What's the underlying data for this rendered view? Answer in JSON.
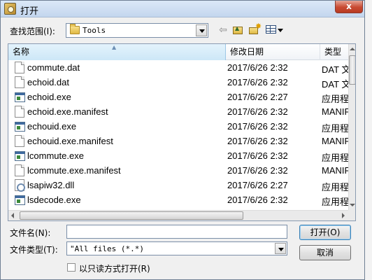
{
  "dialog": {
    "title": "打开",
    "close_label": "x"
  },
  "look_in": {
    "label": "查找范围(I):",
    "value": "Tools"
  },
  "columns": {
    "name": "名称",
    "date": "修改日期",
    "type": "类型"
  },
  "files": [
    {
      "name": "commute.dat",
      "date": "2017/6/26 2:32",
      "type": "DAT 文件",
      "icon": "document-icon"
    },
    {
      "name": "echoid.dat",
      "date": "2017/6/26 2:32",
      "type": "DAT 文件",
      "icon": "document-icon"
    },
    {
      "name": "echoid.exe",
      "date": "2017/6/26 2:27",
      "type": "应用程序",
      "icon": "application-icon"
    },
    {
      "name": "echoid.exe.manifest",
      "date": "2017/6/26 2:32",
      "type": "MANIFEST",
      "icon": "document-icon"
    },
    {
      "name": "echouid.exe",
      "date": "2017/6/26 2:32",
      "type": "应用程序",
      "icon": "application-icon"
    },
    {
      "name": "echouid.exe.manifest",
      "date": "2017/6/26 2:32",
      "type": "MANIFEST",
      "icon": "document-icon"
    },
    {
      "name": "lcommute.exe",
      "date": "2017/6/26 2:32",
      "type": "应用程序",
      "icon": "application-icon"
    },
    {
      "name": "lcommute.exe.manifest",
      "date": "2017/6/26 2:32",
      "type": "MANIFEST",
      "icon": "document-icon"
    },
    {
      "name": "lsapiw32.dll",
      "date": "2017/6/26 2:27",
      "type": "应用程序扩展",
      "icon": "dll-icon"
    },
    {
      "name": "lsdecode.exe",
      "date": "2017/6/26 2:32",
      "type": "应用程序",
      "icon": "application-icon"
    }
  ],
  "filename": {
    "label": "文件名(N):",
    "value": ""
  },
  "filetype": {
    "label": "文件类型(T):",
    "value": "\"All files (*.*)"
  },
  "readonly": {
    "label": "以只读方式打开(R)",
    "checked": false
  },
  "buttons": {
    "open": "打开(O)",
    "cancel": "取消"
  }
}
